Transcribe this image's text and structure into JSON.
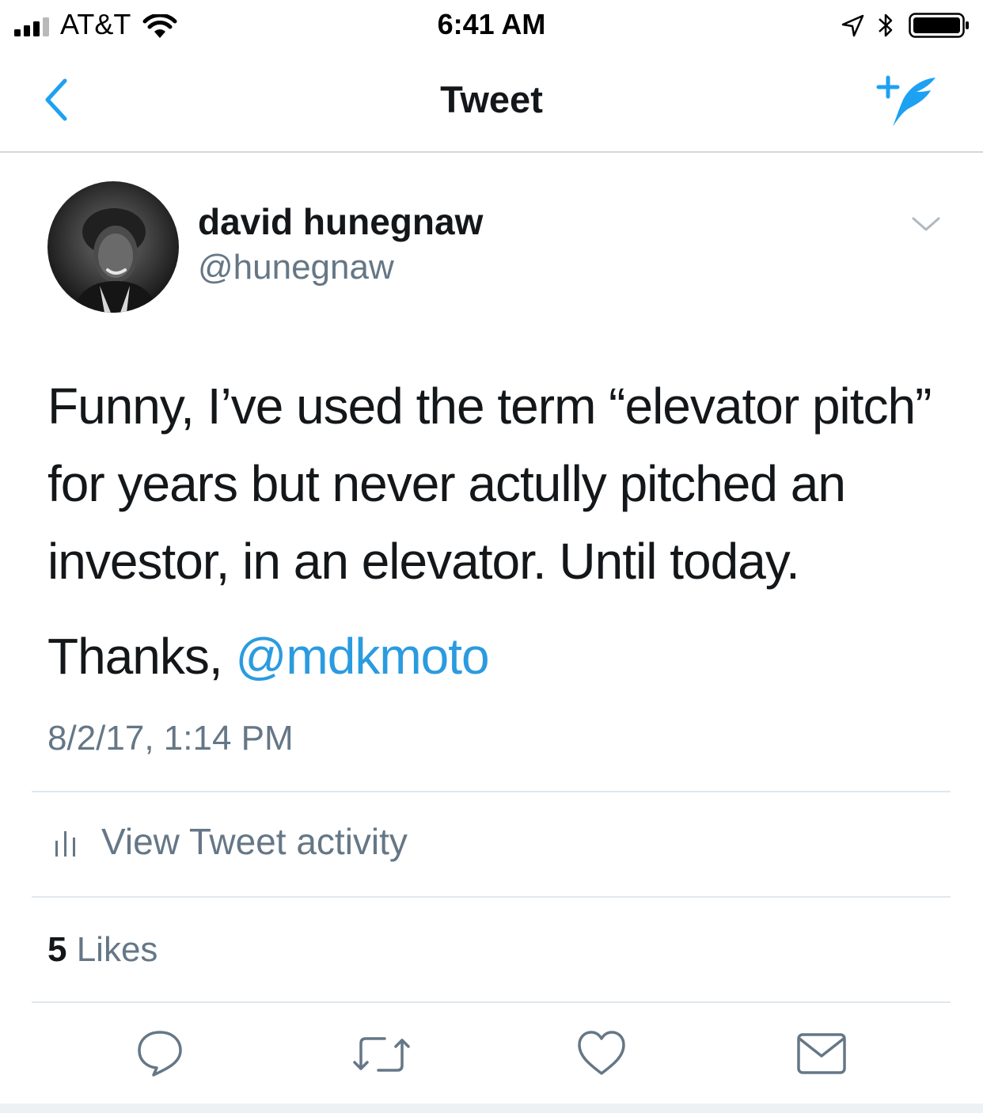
{
  "status_bar": {
    "carrier": "AT&T",
    "time": "6:41 AM",
    "icons": [
      "signal-bars-icon",
      "wifi-icon",
      "location-arrow-icon",
      "bluetooth-icon",
      "battery-icon"
    ]
  },
  "nav": {
    "title": "Tweet",
    "back_icon": "chevron-left-icon",
    "compose_icon": "compose-tweet-icon"
  },
  "tweet": {
    "author": {
      "name": "david hunegnaw",
      "handle": "@hunegnaw"
    },
    "text_line1": "Funny, I’ve used the term “elevator pitch” for years but never actully pitched an investor, in an elevator. Until today.",
    "text_thanks": "Thanks, ",
    "mention": "@mdkmoto",
    "timestamp": "8/2/17, 1:14 PM",
    "activity_label": "View Tweet activity",
    "likes_count": "5",
    "likes_label": " Likes"
  },
  "actions": [
    "reply-icon",
    "retweet-icon",
    "like-icon",
    "direct-message-icon"
  ],
  "colors": {
    "accent": "#1da1f2",
    "text": "#14171a",
    "secondary": "#657786",
    "divider": "#e1e8ed"
  }
}
